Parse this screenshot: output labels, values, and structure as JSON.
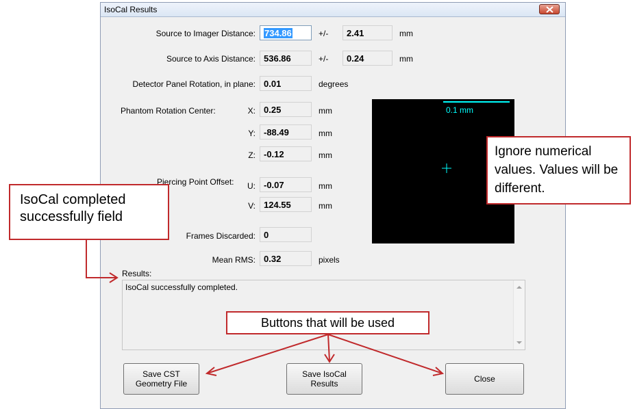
{
  "window": {
    "title": "IsoCal Results"
  },
  "fields": {
    "sid_label": "Source to Imager Distance:",
    "sid_value": "734.86",
    "sid_pm": "+/-",
    "sid_err": "2.41",
    "sid_unit": "mm",
    "sad_label": "Source to Axis Distance:",
    "sad_value": "536.86",
    "sad_pm": "+/-",
    "sad_err": "0.24",
    "sad_unit": "mm",
    "rot_label": "Detector Panel Rotation, in plane:",
    "rot_value": "0.01",
    "rot_unit": "degrees",
    "prc_label": "Phantom Rotation Center:",
    "x_label": "X:",
    "x_value": "0.25",
    "x_unit": "mm",
    "y_label": "Y:",
    "y_value": "-88.49",
    "y_unit": "mm",
    "z_label": "Z:",
    "z_value": "-0.12",
    "z_unit": "mm",
    "ppo_label": "Piercing Point Offset:",
    "u_label": "U:",
    "u_value": "-0.07",
    "u_unit": "mm",
    "v_label": "V:",
    "v_value": "124.55",
    "v_unit": "mm",
    "frames_label": "Frames Discarded:",
    "frames_value": "0",
    "rms_label": "Mean RMS:",
    "rms_value": "0.32",
    "rms_unit": "pixels"
  },
  "plot": {
    "scale_label": "0.1 mm",
    "color": "#00ffff"
  },
  "results": {
    "label": "Results:",
    "text": "IsoCal successfully completed."
  },
  "buttons": {
    "save_cst": "Save CST\nGeometry File",
    "save_isocal": "Save IsoCal\nResults",
    "close": "Close"
  },
  "callouts": {
    "completed": "IsoCal completed successfully field",
    "ignore": "Ignore numerical values.  Values will be different.",
    "buttons": "Buttons that will be used"
  },
  "colors": {
    "callout_border": "#c0292b",
    "highlight": "#3399ff"
  }
}
